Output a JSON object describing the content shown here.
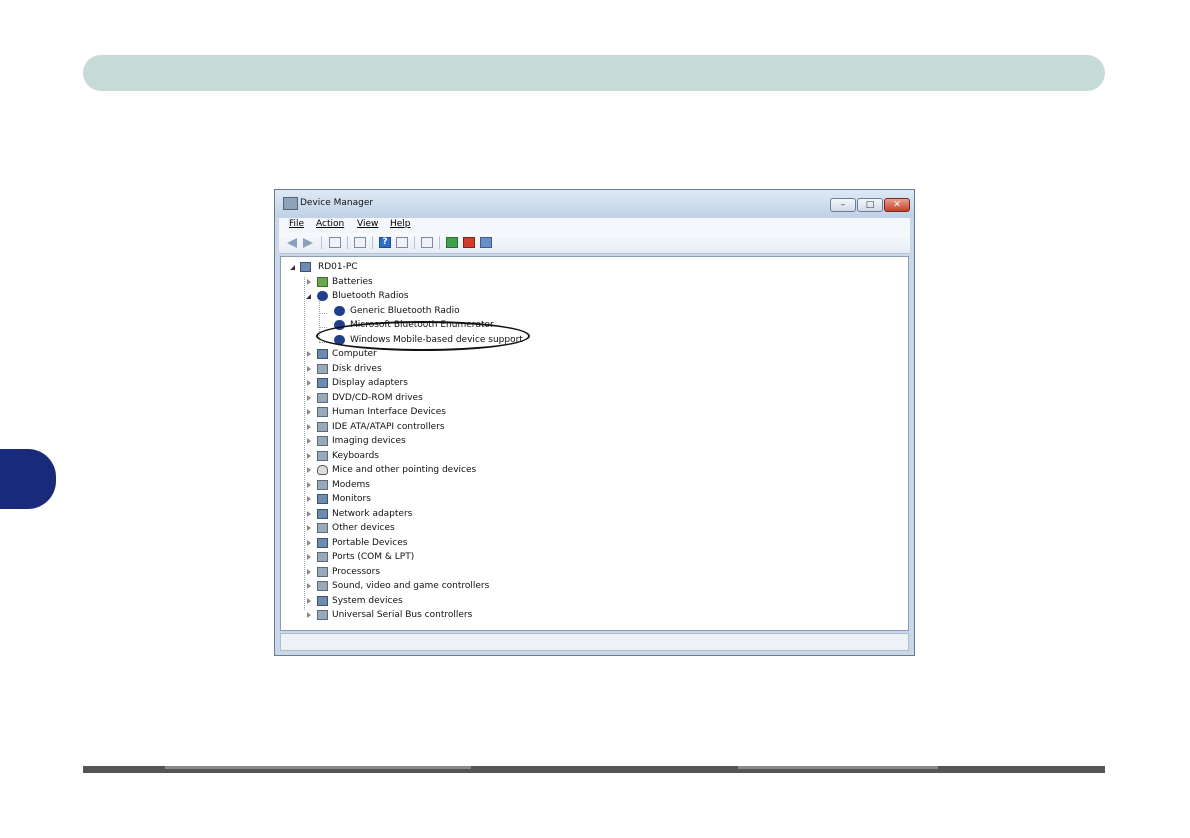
{
  "window": {
    "title": "Device Manager",
    "buttons": {
      "minimize": "–",
      "maximize": "□",
      "close": "✕"
    }
  },
  "menu": [
    "File",
    "Action",
    "View",
    "Help"
  ],
  "toolbar_icons": [
    "back-arrow-icon",
    "forward-arrow-icon",
    "properties-icon",
    "show-hidden-icon",
    "help-icon",
    "view-icon",
    "scan-hardware-icon",
    "update-driver-icon",
    "uninstall-icon",
    "disable-icon"
  ],
  "tree": {
    "root": "RD01-PC",
    "bluetooth_children": [
      "Generic Bluetooth Radio",
      "Microsoft Bluetooth Enumerator",
      "Windows Mobile-based device support"
    ],
    "categories": [
      "Batteries",
      "Bluetooth Radios",
      "Computer",
      "Disk drives",
      "Display adapters",
      "DVD/CD-ROM drives",
      "Human Interface Devices",
      "IDE ATA/ATAPI controllers",
      "Imaging devices",
      "Keyboards",
      "Mice and other pointing devices",
      "Modems",
      "Monitors",
      "Network adapters",
      "Other devices",
      "Portable Devices",
      "Ports (COM & LPT)",
      "Processors",
      "Sound, video and game controllers",
      "System devices",
      "Universal Serial Bus controllers"
    ]
  },
  "colors": {
    "banner": "#c6dbd7",
    "side_tab": "#1a2a7a",
    "bluetooth": "#1f3f8a"
  }
}
